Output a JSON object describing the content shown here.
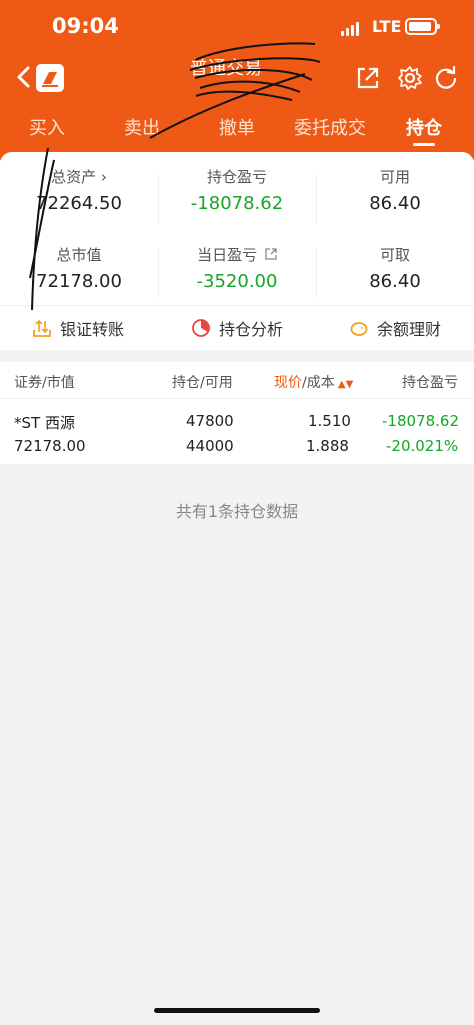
{
  "status_bar": {
    "time": "09:04",
    "network": "LTE"
  },
  "nav": {
    "title": "普通交易"
  },
  "tabs": [
    {
      "label": "买入"
    },
    {
      "label": "卖出"
    },
    {
      "label": "撤单"
    },
    {
      "label": "委托成交"
    },
    {
      "label": "持仓",
      "active": true
    }
  ],
  "summary": {
    "total_assets": {
      "label": "总资产",
      "value": "72264.50"
    },
    "position_pl": {
      "label": "持仓盈亏",
      "value": "-18078.62"
    },
    "available": {
      "label": "可用",
      "value": "86.40"
    },
    "market_value": {
      "label": "总市值",
      "value": "72178.00"
    },
    "daily_pl": {
      "label": "当日盈亏",
      "value": "-3520.00"
    },
    "withdrawable": {
      "label": "可取",
      "value": "86.40"
    }
  },
  "actions": [
    {
      "label": "银证转账",
      "icon": "transfer-icon"
    },
    {
      "label": "持仓分析",
      "icon": "pie-chart-icon"
    },
    {
      "label": "余额理财",
      "icon": "piggy-bank-icon"
    }
  ],
  "table": {
    "headers": {
      "security": "证券",
      "market": "市值",
      "position": "持仓",
      "avail": "可用",
      "price": "现价",
      "cost": "成本",
      "pl": "持仓盈亏"
    },
    "rows": [
      {
        "name": "*ST 西源",
        "market_value": "72178.00",
        "position": "47800",
        "available": "44000",
        "price": "1.510",
        "cost": "1.888",
        "pl": "-18078.62",
        "pl_pct": "-20.021%"
      }
    ]
  },
  "empty_text": "共有1条持仓数据",
  "colors": {
    "accent": "#ee5a16",
    "loss": "#15a626"
  }
}
